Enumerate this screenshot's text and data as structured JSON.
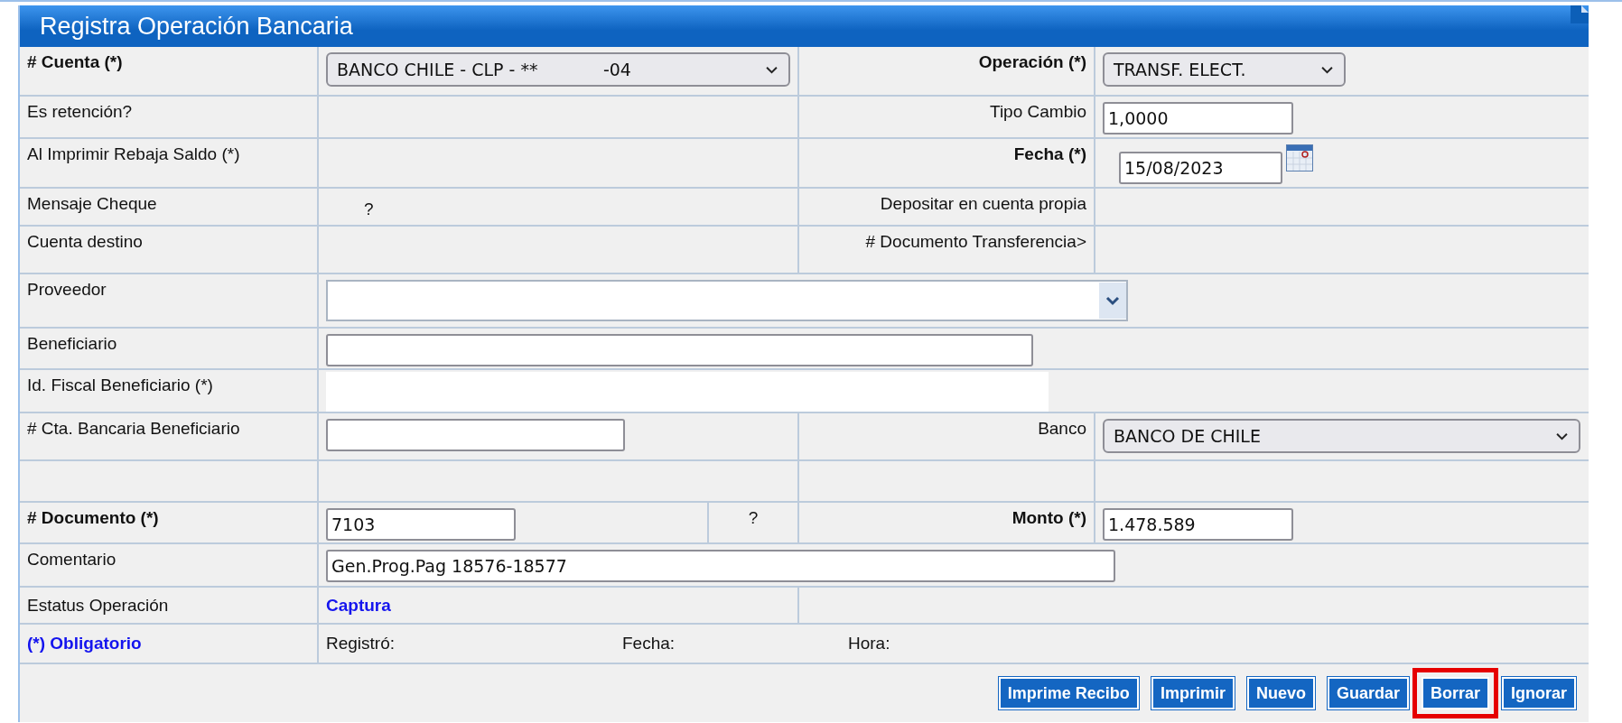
{
  "window": {
    "title": "Registra Operación Bancaria"
  },
  "rows": [
    {
      "kind": "pair",
      "label": {
        "text": "# Cuenta (*)",
        "bold": true
      },
      "field": {
        "kind": "select",
        "value": "BANCO CHILE - CLP - **            -04"
      },
      "right_label": {
        "text": "Operación (*)",
        "bold": true
      },
      "right_field": {
        "kind": "select",
        "value": "TRANSF. ELECT."
      }
    },
    {
      "kind": "pair",
      "label": {
        "text": "Es retención?",
        "bold": false
      },
      "right_label": {
        "text": "Tipo Cambio",
        "bold": false
      },
      "right_field": {
        "kind": "input",
        "value": "1,0000"
      }
    },
    {
      "kind": "pair",
      "label": {
        "text": "Al Imprimir Rebaja Saldo (*)",
        "bold": false
      },
      "right_label": {
        "text": "Fecha (*)",
        "bold": true
      },
      "right_field": {
        "kind": "date",
        "value": "15/08/2023"
      }
    },
    {
      "kind": "pair",
      "label": {
        "text": "Mensaje Cheque",
        "bold": false
      },
      "field": {
        "kind": "text",
        "value": "?"
      },
      "right_label": {
        "text": "Depositar en cuenta propia",
        "bold": false
      }
    },
    {
      "kind": "pair",
      "label": {
        "text": "Cuenta destino",
        "bold": false
      },
      "right_label": {
        "text": "# Documento Transferencia>",
        "bold": false
      }
    },
    {
      "kind": "wide",
      "label": {
        "text": "Proveedor",
        "bold": false
      },
      "field": {
        "kind": "combo"
      }
    },
    {
      "kind": "wide",
      "label": {
        "text": "Beneficiario",
        "bold": false
      },
      "field": {
        "kind": "input"
      }
    },
    {
      "kind": "wide",
      "label": {
        "text": "Id. Fiscal Beneficiario (*)",
        "bold": false
      },
      "field": {
        "kind": "blank"
      }
    },
    {
      "kind": "pair",
      "label": {
        "text": "# Cta. Bancaria Beneficiario",
        "bold": false
      },
      "field": {
        "kind": "input"
      },
      "right_label": {
        "text": "Banco",
        "bold": false
      },
      "right_field": {
        "kind": "select",
        "value": "BANCO DE CHILE"
      }
    },
    {
      "kind": "spacer"
    },
    {
      "kind": "pair",
      "label": {
        "text": "# Documento (*)",
        "bold": true
      },
      "field": {
        "kind": "input",
        "value": "7103"
      },
      "hint": "?",
      "right_label": {
        "text": "Monto (*)",
        "bold": true
      },
      "right_field": {
        "kind": "input",
        "value": "1.478.589"
      }
    },
    {
      "kind": "wide",
      "label": {
        "text": "Comentario",
        "bold": false
      },
      "field": {
        "kind": "input",
        "value": "Gen.Prog.Pag 18576-18577"
      }
    },
    {
      "kind": "status",
      "label": {
        "text": "Estatus Operación",
        "bold": false
      },
      "status": "Captura"
    },
    {
      "kind": "footer",
      "note": "(*) Obligatorio",
      "items": [
        "Registró:",
        "Fecha:",
        "Hora:"
      ]
    },
    {
      "kind": "buttons",
      "buttons": [
        {
          "label": "Imprime Recibo",
          "highlighted": false
        },
        {
          "label": "Imprimir",
          "highlighted": false
        },
        {
          "label": "Nuevo",
          "highlighted": false
        },
        {
          "label": "Guardar",
          "highlighted": false
        },
        {
          "label": "Borrar",
          "highlighted": true
        },
        {
          "label": "Ignorar",
          "highlighted": false
        }
      ]
    }
  ]
}
